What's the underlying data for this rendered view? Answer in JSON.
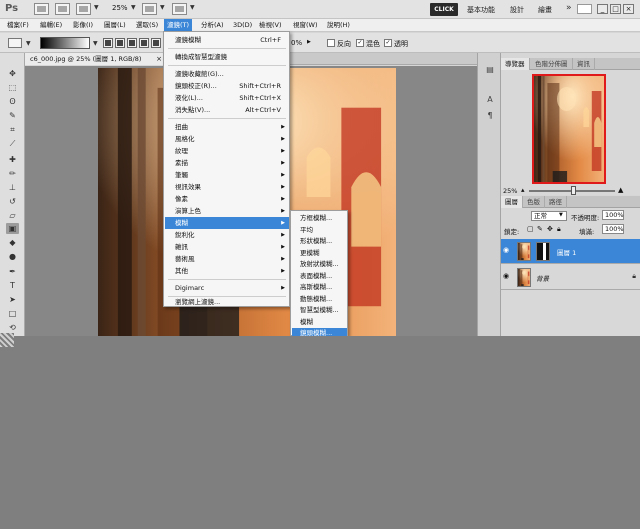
{
  "titlebar": {
    "app_logo": "Ps",
    "zoom_value": "25%",
    "click_button": "CLICK",
    "workspaces": [
      "基本功能",
      "設計",
      "繪畫"
    ],
    "overflow": "»",
    "window_buttons": [
      "_",
      "□",
      "×"
    ]
  },
  "menubar": {
    "items": [
      "檔案(F)",
      "編輯(E)",
      "影像(I)",
      "圖層(L)",
      "選取(S)",
      "濾鏡(T)",
      "分析(A)",
      "3D(D)",
      "檢視(V)",
      "視窗(W)",
      "說明(H)"
    ]
  },
  "options": {
    "opacity_tail": "0%",
    "reverse": "反向",
    "dither": "混色",
    "transparency": "透明"
  },
  "document": {
    "tab_title": "c6_000.jpg @ 25% (圖層 1, RGB/8)",
    "close": "×"
  },
  "filter_menu": {
    "last_filter": {
      "label": "濾鏡模糊",
      "shortcut": "Ctrl+F"
    },
    "smart_filter": "轉換成智慧型濾鏡",
    "gallery": "濾鏡收藏館(G)...",
    "lens_correction": {
      "label": "鏡頭校正(R)...",
      "shortcut": "Shift+Ctrl+R"
    },
    "liquify": {
      "label": "液化(L)...",
      "shortcut": "Shift+Ctrl+X"
    },
    "vanishing_point": {
      "label": "消失點(V)...",
      "shortcut": "Alt+Ctrl+V"
    },
    "groups": [
      "扭曲",
      "風格化",
      "紋理",
      "素描",
      "筆觸",
      "視訊效果",
      "像素",
      "演算上色",
      "模糊",
      "銳利化",
      "雜訊",
      "藝術風",
      "其他"
    ],
    "digimarc": "Digimarc",
    "browse_online": "瀏覽網上濾鏡..."
  },
  "blur_menu": {
    "items": [
      "方框模糊...",
      "平均",
      "形狀模糊...",
      "更模糊",
      "放射狀模糊...",
      "表面模糊...",
      "高斯模糊...",
      "動態模糊...",
      "智慧型模糊...",
      "模糊",
      "鏡頭模糊..."
    ],
    "highlighted_index": 10
  },
  "navigator": {
    "tabs": [
      "導覽器",
      "色階分佈圖",
      "資訊"
    ],
    "zoom": "25%"
  },
  "layers": {
    "tabs": [
      "圖層",
      "色版",
      "路徑"
    ],
    "blend_mode": "正常",
    "opacity_label": "不透明度:",
    "opacity_value": "100%",
    "lock_label": "鎖定:",
    "fill_label": "填滿:",
    "fill_value": "100%",
    "rows": [
      {
        "name": "圖層 1",
        "selected": true
      },
      {
        "name": "背景",
        "selected": false
      }
    ]
  },
  "colors": {
    "highlight": "#3b86d6",
    "nav_frame": "#e01a1a"
  }
}
